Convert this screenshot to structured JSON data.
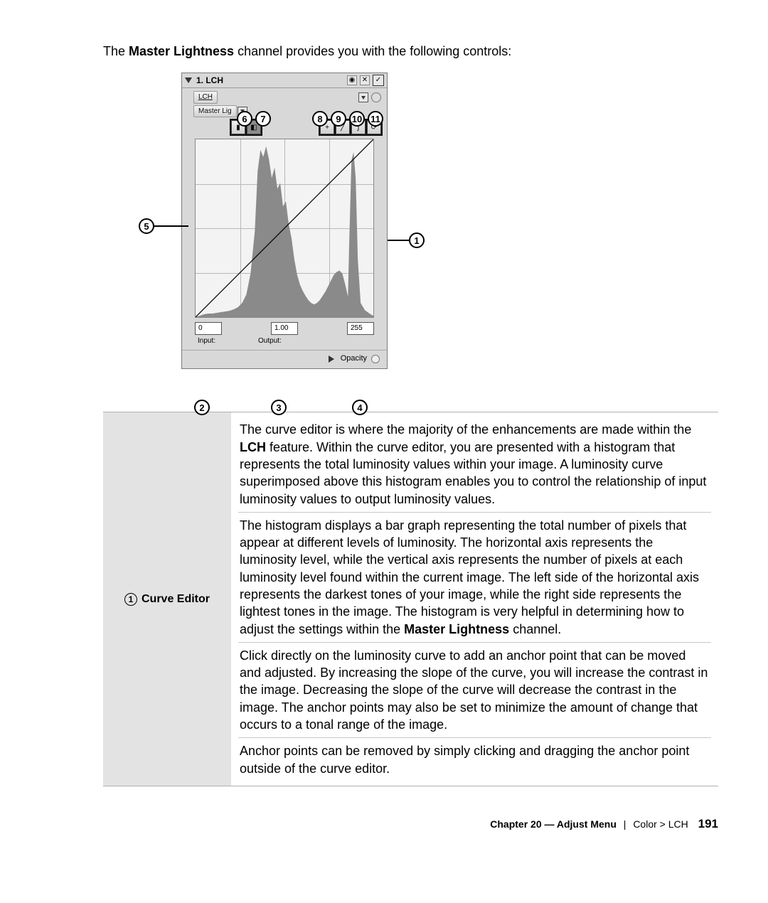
{
  "intro_prefix": "The ",
  "intro_bold": "Master Lightness",
  "intro_suffix": " channel provides you with the following controls:",
  "panel": {
    "title": "1. LCH",
    "lch_button": "LCH",
    "channel_label": "Master Lig",
    "low_value": "0",
    "gamma_value": "1.00",
    "high_value": "255",
    "input_label": "Input:",
    "output_label": "Output:",
    "opacity_label": "Opacity"
  },
  "callouts": {
    "n1": "1",
    "n2": "2",
    "n3": "3",
    "n4": "4",
    "n5": "5",
    "n6": "6",
    "n7": "7",
    "n8": "8",
    "n9": "9",
    "n10": "10",
    "n11": "11"
  },
  "table": {
    "label_num": "1",
    "label_text": "Curve Editor",
    "p1a": "The curve editor is where the majority of the enhancements are made within the ",
    "p1b": "LCH",
    "p1c": " feature. Within the curve editor, you are presented with a histogram that represents the total luminosity values within your image. A luminosity curve superimposed above this histogram enables you to control the relationship of input luminosity values to output luminosity values.",
    "p2a": "The histogram displays a bar graph representing the total number of pixels that appear at different levels of luminosity. The horizontal axis represents the luminosity level, while the vertical axis represents the number of pixels at each luminosity level found within the current image. The left side of the horizontal axis represents the darkest tones of your image, while the right side represents the lightest tones in the image. The histogram is very helpful in determining how to adjust the settings within the ",
    "p2b": "Master Lightness",
    "p2c": " channel.",
    "p3": "Click directly on the luminosity curve to add an anchor point that can be moved and adjusted. By increasing the slope of the curve, you will increase the contrast in the image. Decreasing the slope of the curve will decrease the contrast in the image. The anchor points may also be set to minimize the amount of change that occurs to a tonal range of the image.",
    "p4": "Anchor points can be removed by simply clicking and dragging the anchor point outside of the curve editor."
  },
  "footer": {
    "chapter": "Chapter 20 — Adjust Menu",
    "breadcrumb": "Color > LCH",
    "page": "191"
  }
}
